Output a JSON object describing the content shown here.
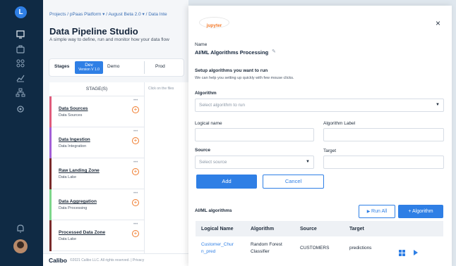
{
  "colors": {
    "rail": "#0f2a44",
    "accent": "#2f7fe5",
    "orange": "#f07a2a"
  },
  "rail": {
    "logo": "L",
    "icons": [
      "dashboard-icon",
      "briefcase-icon",
      "grid-icon",
      "chart-icon",
      "hierarchy-icon",
      "settings-icon",
      "bell-icon"
    ]
  },
  "page": {
    "breadcrumb": "Projects / pPaas Platform ▾ / August Beta 2.0 ▾ / Data Inte",
    "title": "Data Pipeline Studio",
    "subtitle": "A simple way to define, run and monitor how your data flow",
    "stages": {
      "label": "Stages",
      "dev": "Dev",
      "dev_version": "Version V 1.0",
      "demo": "Demo",
      "prod": "Prod"
    },
    "table": {
      "header": "STAGE(S)",
      "hint": "Click on the files",
      "rows": [
        {
          "name": "Data Sources",
          "sub": "Data Sources",
          "color": "#e05b7b"
        },
        {
          "name": "Data Ingestion",
          "sub": "Data Integration",
          "color": "#a35fd6"
        },
        {
          "name": "Raw Landing Zone",
          "sub": "Data Lake",
          "color": "#7a2b2b"
        },
        {
          "name": "Data Aggregation",
          "sub": "Data Processing",
          "color": "#7dd68a"
        },
        {
          "name": "Processed Data Zone",
          "sub": "Data Lake",
          "color": "#7a2b2b"
        }
      ]
    },
    "footer": {
      "logo": "Calibo",
      "copyright": "©2021 Calibo LLC. All rights reserved.  |  Privacy"
    }
  },
  "modal": {
    "logo_text": "jupyter",
    "close": "×",
    "name_label": "Name",
    "name_value": "AI/ML Algorithms Processing",
    "setup_title": "Setup algorithms you want to run",
    "setup_hint": "We can help you setting up quickly with few mouse clicks.",
    "algorithm_label": "Algorithm",
    "algorithm_placeholder": "Select algorithm to run",
    "logical_name_label": "Logical name",
    "algorithm_label_label": "Algorithm Label",
    "source_label": "Source",
    "source_placeholder": "Select source",
    "target_label": "Target",
    "add": "Add",
    "cancel": "Cancel",
    "list_title": "AI/ML algorithms",
    "run_all": "Run All",
    "add_algorithm": "+ Algorithm",
    "columns": [
      "Logical Name",
      "Algorithm",
      "Source",
      "Target"
    ],
    "rows": [
      {
        "logical_name_1": "Customer_Chur",
        "logical_name_2": "n_pred",
        "algorithm_1": "Random Forest",
        "algorithm_2": "Classifier",
        "source": "CUSTOMERS",
        "target": "predictions"
      }
    ]
  }
}
